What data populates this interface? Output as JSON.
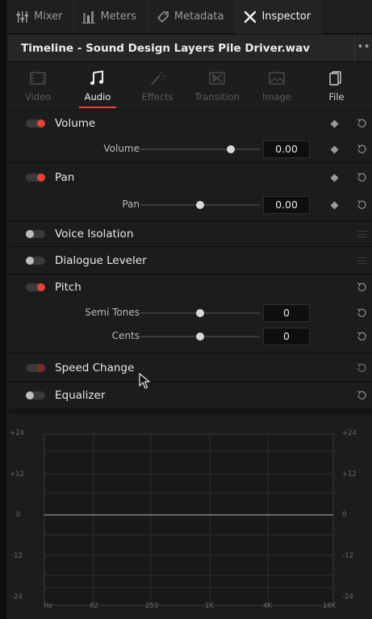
{
  "toolbar": {
    "items": [
      {
        "label": "Mixer",
        "icon": "mixer-icon"
      },
      {
        "label": "Meters",
        "icon": "meters-icon"
      },
      {
        "label": "Metadata",
        "icon": "metadata-icon"
      },
      {
        "label": "Inspector",
        "icon": "inspector-icon",
        "active": true
      }
    ]
  },
  "titlebar": {
    "title": "Timeline - Sound Design Layers Pile Driver.wav",
    "more": "••"
  },
  "tabs": [
    {
      "label": "Video",
      "icon": "video-icon"
    },
    {
      "label": "Audio",
      "icon": "audio-note-icon",
      "active": true
    },
    {
      "label": "Effects",
      "icon": "effects-wand-icon"
    },
    {
      "label": "Transition",
      "icon": "transition-icon"
    },
    {
      "label": "Image",
      "icon": "image-icon"
    },
    {
      "label": "File",
      "icon": "file-icon"
    }
  ],
  "sections": {
    "volume": {
      "title": "Volume",
      "enabled": true,
      "param_label": "Volume",
      "value": "0.00",
      "slider_level": 0.76
    },
    "pan": {
      "title": "Pan",
      "enabled": true,
      "param_label": "Pan",
      "value": "0.00",
      "slider_level": 0.5
    },
    "voice_isolation": {
      "title": "Voice Isolation",
      "enabled": false
    },
    "dialogue_leveler": {
      "title": "Dialogue Leveler",
      "enabled": false
    },
    "pitch": {
      "title": "Pitch",
      "enabled": true,
      "semi_tones_label": "Semi Tones",
      "semi_tones_value": "0",
      "semi_tones_level": 0.5,
      "cents_label": "Cents",
      "cents_value": "0",
      "cents_level": 0.5
    },
    "speed_change": {
      "title": "Speed Change",
      "enabled": false
    },
    "equalizer": {
      "title": "Equalizer",
      "enabled": false
    }
  },
  "equalizer_graph": {
    "y_labels": [
      "+24",
      "+12",
      "0",
      "-12",
      "-24"
    ],
    "x_labels": [
      "Hz",
      "62",
      "250",
      "1K",
      "4K",
      "16K"
    ]
  },
  "colors": {
    "accent": "#e2433a",
    "background": "#1c1c1c"
  }
}
